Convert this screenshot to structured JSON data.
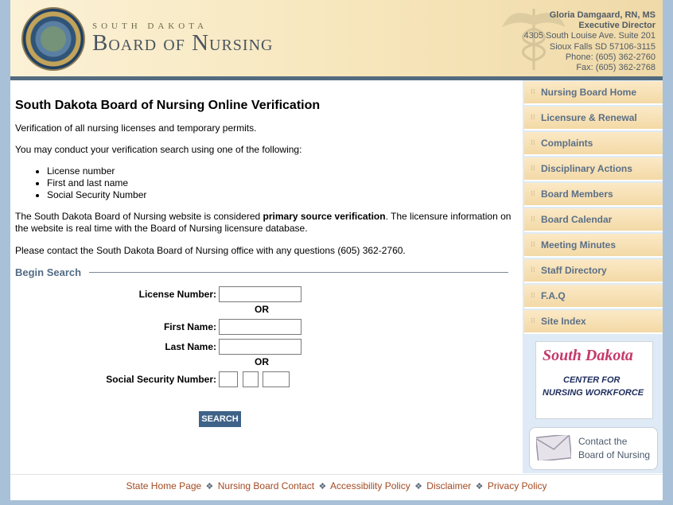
{
  "header": {
    "state": "SOUTH DAKOTA",
    "org": "Board of Nursing",
    "contact": {
      "name": "Gloria Damgaard, RN, MS",
      "title": "Executive Director",
      "address1": "4305 South Louise Ave. Suite 201",
      "address2": "Sioux Falls SD  57106-3115",
      "phone": "Phone: (605) 362-2760",
      "fax": "Fax: (605) 362-2768"
    }
  },
  "main": {
    "heading": "South Dakota Board of Nursing Online Verification",
    "intro": "Verification of all nursing licenses and temporary permits.",
    "methods_intro": "You may conduct your verification search using one of the following:",
    "methods": [
      "License number",
      "First and last name",
      "Social Security Number"
    ],
    "primary_pre": "The South Dakota Board of Nursing website is considered ",
    "primary_bold": "primary source verification",
    "primary_post": ". The licensure information on the website is real time with the Board of Nursing licensure database.",
    "contact_note": "Please contact the South Dakota Board of Nursing office with any questions (605) 362-2760."
  },
  "search": {
    "legend": "Begin Search",
    "license_label": "License Number:",
    "license_value": "",
    "or": "OR",
    "first_label": "First Name:",
    "first_value": "",
    "last_label": "Last Name:",
    "last_value": "",
    "ssn_label": "Social Security Number:",
    "ssn": [
      "",
      "",
      ""
    ],
    "button": "SEARCH"
  },
  "sidebar": {
    "items": [
      {
        "label": "Nursing Board Home"
      },
      {
        "label": "Licensure & Renewal"
      },
      {
        "label": "Complaints"
      },
      {
        "label": "Disciplinary Actions"
      },
      {
        "label": "Board Members"
      },
      {
        "label": "Board Calendar"
      },
      {
        "label": "Meeting Minutes"
      },
      {
        "label": "Staff Directory"
      },
      {
        "label": "F.A.Q"
      },
      {
        "label": "Site Index"
      }
    ],
    "workforce": {
      "state": "South Dakota",
      "line1": "CENTER FOR",
      "line2": "NURSING WORKFORCE"
    },
    "contact_line1": "Contact the",
    "contact_line2": "Board of Nursing"
  },
  "footer": {
    "links": [
      "State Home Page",
      "Nursing Board Contact",
      "Accessibility Policy",
      "Disclaimer",
      "Privacy Policy"
    ],
    "separator": "❖"
  },
  "colors": {
    "accent": "#3f6388",
    "nav_text": "#5b6f87",
    "footer_link": "#a34a22",
    "header_bar": "#536b7f"
  }
}
